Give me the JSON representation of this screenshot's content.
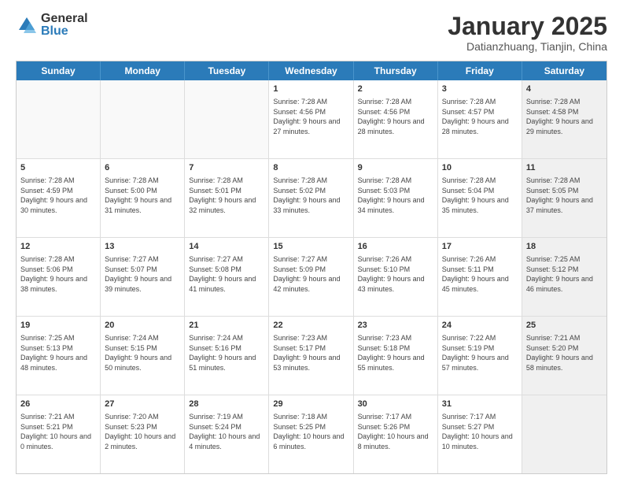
{
  "logo": {
    "general": "General",
    "blue": "Blue"
  },
  "header": {
    "title": "January 2025",
    "subtitle": "Datianzhuang, Tianjin, China"
  },
  "days": [
    "Sunday",
    "Monday",
    "Tuesday",
    "Wednesday",
    "Thursday",
    "Friday",
    "Saturday"
  ],
  "weeks": [
    [
      {
        "day": "",
        "empty": true
      },
      {
        "day": "",
        "empty": true
      },
      {
        "day": "",
        "empty": true
      },
      {
        "day": "1",
        "sunrise": "7:28 AM",
        "sunset": "4:56 PM",
        "daylight": "9 hours and 27 minutes."
      },
      {
        "day": "2",
        "sunrise": "7:28 AM",
        "sunset": "4:56 PM",
        "daylight": "9 hours and 28 minutes."
      },
      {
        "day": "3",
        "sunrise": "7:28 AM",
        "sunset": "4:57 PM",
        "daylight": "9 hours and 28 minutes."
      },
      {
        "day": "4",
        "sunrise": "7:28 AM",
        "sunset": "4:58 PM",
        "daylight": "9 hours and 29 minutes.",
        "shaded": true
      }
    ],
    [
      {
        "day": "5",
        "sunrise": "7:28 AM",
        "sunset": "4:59 PM",
        "daylight": "9 hours and 30 minutes."
      },
      {
        "day": "6",
        "sunrise": "7:28 AM",
        "sunset": "5:00 PM",
        "daylight": "9 hours and 31 minutes."
      },
      {
        "day": "7",
        "sunrise": "7:28 AM",
        "sunset": "5:01 PM",
        "daylight": "9 hours and 32 minutes."
      },
      {
        "day": "8",
        "sunrise": "7:28 AM",
        "sunset": "5:02 PM",
        "daylight": "9 hours and 33 minutes."
      },
      {
        "day": "9",
        "sunrise": "7:28 AM",
        "sunset": "5:03 PM",
        "daylight": "9 hours and 34 minutes."
      },
      {
        "day": "10",
        "sunrise": "7:28 AM",
        "sunset": "5:04 PM",
        "daylight": "9 hours and 35 minutes."
      },
      {
        "day": "11",
        "sunrise": "7:28 AM",
        "sunset": "5:05 PM",
        "daylight": "9 hours and 37 minutes.",
        "shaded": true
      }
    ],
    [
      {
        "day": "12",
        "sunrise": "7:28 AM",
        "sunset": "5:06 PM",
        "daylight": "9 hours and 38 minutes."
      },
      {
        "day": "13",
        "sunrise": "7:27 AM",
        "sunset": "5:07 PM",
        "daylight": "9 hours and 39 minutes."
      },
      {
        "day": "14",
        "sunrise": "7:27 AM",
        "sunset": "5:08 PM",
        "daylight": "9 hours and 41 minutes."
      },
      {
        "day": "15",
        "sunrise": "7:27 AM",
        "sunset": "5:09 PM",
        "daylight": "9 hours and 42 minutes."
      },
      {
        "day": "16",
        "sunrise": "7:26 AM",
        "sunset": "5:10 PM",
        "daylight": "9 hours and 43 minutes."
      },
      {
        "day": "17",
        "sunrise": "7:26 AM",
        "sunset": "5:11 PM",
        "daylight": "9 hours and 45 minutes."
      },
      {
        "day": "18",
        "sunrise": "7:25 AM",
        "sunset": "5:12 PM",
        "daylight": "9 hours and 46 minutes.",
        "shaded": true
      }
    ],
    [
      {
        "day": "19",
        "sunrise": "7:25 AM",
        "sunset": "5:13 PM",
        "daylight": "9 hours and 48 minutes."
      },
      {
        "day": "20",
        "sunrise": "7:24 AM",
        "sunset": "5:15 PM",
        "daylight": "9 hours and 50 minutes."
      },
      {
        "day": "21",
        "sunrise": "7:24 AM",
        "sunset": "5:16 PM",
        "daylight": "9 hours and 51 minutes."
      },
      {
        "day": "22",
        "sunrise": "7:23 AM",
        "sunset": "5:17 PM",
        "daylight": "9 hours and 53 minutes."
      },
      {
        "day": "23",
        "sunrise": "7:23 AM",
        "sunset": "5:18 PM",
        "daylight": "9 hours and 55 minutes."
      },
      {
        "day": "24",
        "sunrise": "7:22 AM",
        "sunset": "5:19 PM",
        "daylight": "9 hours and 57 minutes."
      },
      {
        "day": "25",
        "sunrise": "7:21 AM",
        "sunset": "5:20 PM",
        "daylight": "9 hours and 58 minutes.",
        "shaded": true
      }
    ],
    [
      {
        "day": "26",
        "sunrise": "7:21 AM",
        "sunset": "5:21 PM",
        "daylight": "10 hours and 0 minutes."
      },
      {
        "day": "27",
        "sunrise": "7:20 AM",
        "sunset": "5:23 PM",
        "daylight": "10 hours and 2 minutes."
      },
      {
        "day": "28",
        "sunrise": "7:19 AM",
        "sunset": "5:24 PM",
        "daylight": "10 hours and 4 minutes."
      },
      {
        "day": "29",
        "sunrise": "7:18 AM",
        "sunset": "5:25 PM",
        "daylight": "10 hours and 6 minutes."
      },
      {
        "day": "30",
        "sunrise": "7:17 AM",
        "sunset": "5:26 PM",
        "daylight": "10 hours and 8 minutes."
      },
      {
        "day": "31",
        "sunrise": "7:17 AM",
        "sunset": "5:27 PM",
        "daylight": "10 hours and 10 minutes."
      },
      {
        "day": "",
        "empty": true,
        "shaded": true
      }
    ]
  ]
}
